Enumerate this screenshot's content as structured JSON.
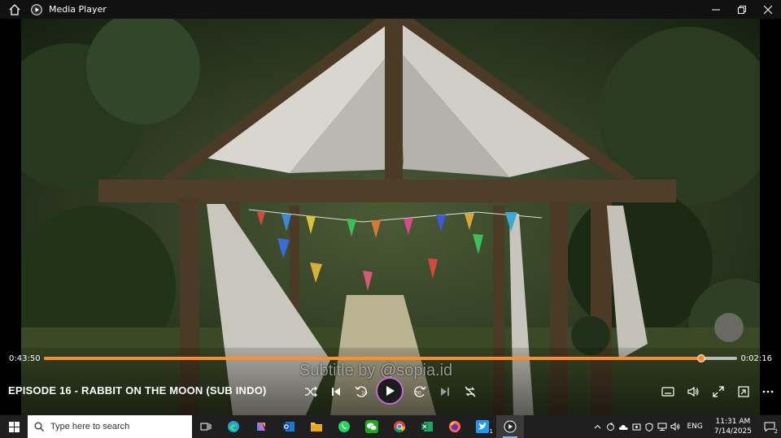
{
  "window": {
    "title": "Media Player",
    "controls": [
      "minimize",
      "maximize",
      "close"
    ]
  },
  "player": {
    "elapsed": "0:43:50",
    "remaining": "0:02:16",
    "progress": 0.948,
    "episode_title": "EPISODE 16 - RABBIT ON THE MOON (SUB INDO)",
    "subtitle_watermark": "Subtitle by @sopia.id",
    "accent_color": "#ff8c2b",
    "play_ring_color": "#c06ad6",
    "transport_icons": [
      "shuffle-icon",
      "previous-icon",
      "rewind-10-icon",
      "play-icon",
      "forward-30-icon",
      "next-icon",
      "repeat-off-icon"
    ],
    "right_icons": [
      "subtitles-icon",
      "volume-icon",
      "fullscreen-icon",
      "mini-player-icon",
      "more-icon"
    ],
    "rewind_label": "10",
    "forward_label": "30"
  },
  "taskbar": {
    "search_placeholder": "Type here to search",
    "apps": [
      "task-view-icon",
      "edge-icon",
      "copilot-icon",
      "outlook-icon",
      "file-explorer-icon",
      "whatsapp-icon",
      "wechat-icon",
      "chrome-icon",
      "excel-icon",
      "firefox-icon",
      "twitter-icon",
      "media-player-icon"
    ],
    "twitter_badge": "1",
    "language": "ENG",
    "time": "11:31 AM",
    "date": "7/14/2025",
    "notification_count": "2"
  }
}
